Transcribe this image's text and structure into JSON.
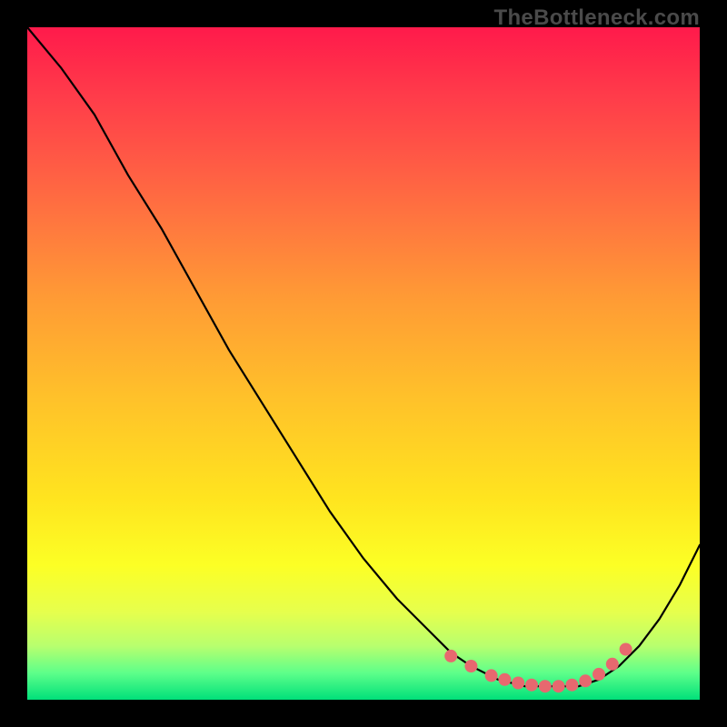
{
  "watermark": "TheBottleneck.com",
  "chart_data": {
    "type": "line",
    "title": "",
    "xlabel": "",
    "ylabel": "",
    "xlim": [
      0,
      100
    ],
    "ylim": [
      0,
      100
    ],
    "grid": false,
    "legend": false,
    "series": [
      {
        "name": "curve",
        "color": "#000000",
        "x": [
          0,
          5,
          10,
          15,
          20,
          25,
          30,
          35,
          40,
          45,
          50,
          55,
          60,
          63,
          66,
          70,
          74,
          78,
          82,
          85,
          88,
          91,
          94,
          97,
          100
        ],
        "y": [
          100,
          94,
          87,
          78,
          70,
          61,
          52,
          44,
          36,
          28,
          21,
          15,
          10,
          7,
          5,
          3,
          2,
          2,
          2,
          3,
          5,
          8,
          12,
          17,
          23
        ]
      }
    ],
    "markers": {
      "name": "marker-dots",
      "color": "#e7686f",
      "radius_px": 7,
      "x": [
        63,
        66,
        69,
        71,
        73,
        75,
        77,
        79,
        81,
        83,
        85,
        87,
        89
      ],
      "y": [
        6.5,
        5,
        3.6,
        3.0,
        2.5,
        2.2,
        2.0,
        2.0,
        2.2,
        2.8,
        3.8,
        5.3,
        7.5
      ]
    }
  }
}
